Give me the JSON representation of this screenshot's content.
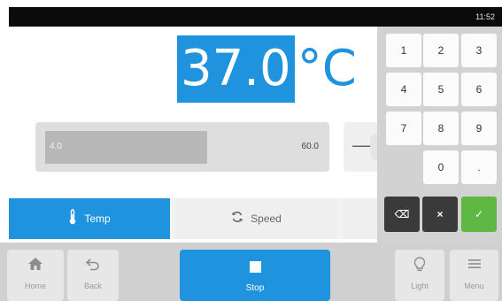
{
  "status": {
    "time": "11:52"
  },
  "temperature": {
    "value": "37.0",
    "unit": "°C"
  },
  "range": {
    "min": "4.0",
    "max": "60.0",
    "fill_fraction": 0.58
  },
  "stepper": {
    "minus": "—"
  },
  "tabs": [
    {
      "label": "Temp",
      "icon": "thermometer-icon",
      "active": true
    },
    {
      "label": "Speed",
      "icon": "refresh-icon",
      "active": false
    }
  ],
  "keypad": {
    "keys": [
      "1",
      "2",
      "3",
      "4",
      "5",
      "6",
      "7",
      "8",
      "9",
      "0",
      "."
    ],
    "backspace": "⌫",
    "clear": "×",
    "confirm": "✓"
  },
  "bottom": {
    "home": "Home",
    "back": "Back",
    "stop": "Stop",
    "light": "Light",
    "menu": "Menu"
  },
  "colors": {
    "accent": "#1f93dd",
    "confirm": "#5fb844",
    "dark_key": "#3a3a3a"
  }
}
